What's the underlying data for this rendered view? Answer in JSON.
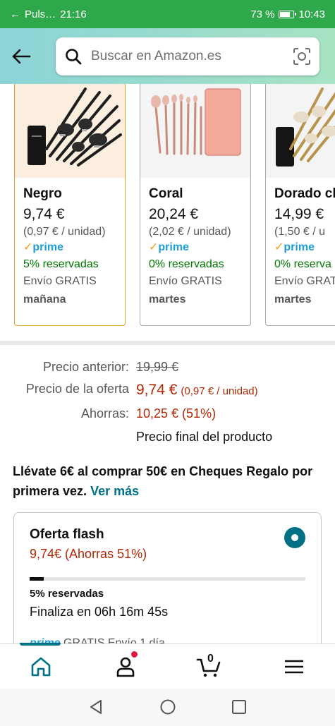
{
  "status_bar": {
    "app_label": "Puls…",
    "time_left": "21:16",
    "battery": "73 %",
    "time_right": "10:43"
  },
  "header": {
    "search_placeholder": "Buscar en Amazon.es"
  },
  "variants": [
    {
      "name": "Negro",
      "price": "9,74 €",
      "unit_price": "(0,97 € / unidad)",
      "prime": "prime",
      "reserved": "5% reservadas",
      "shipping": "Envío GRATIS",
      "delivery": "mañana",
      "selected": true
    },
    {
      "name": "Coral",
      "price": "20,24 €",
      "unit_price": "(2,02 € / unidad)",
      "prime": "prime",
      "reserved": "0% reservadas",
      "shipping": "Envío GRATIS",
      "delivery": "martes",
      "selected": false
    },
    {
      "name": "Dorado cl",
      "price": "14,99 €",
      "unit_price": "(1,50 € / u",
      "prime": "prime",
      "reserved": "0% reserva",
      "shipping": "Envío GRAT",
      "delivery": "martes",
      "selected": false
    }
  ],
  "pricing": {
    "previous_label": "Precio anterior:",
    "previous_value": "19,99 €",
    "offer_label": "Precio de la oferta",
    "offer_value": "9,74 €",
    "offer_unit": "(0,97 € / unidad)",
    "savings_label": "Ahorras:",
    "savings_value": "10,25 € (51%)",
    "final_note": "Precio final del producto"
  },
  "promo": {
    "text": "Llévate 6€ al comprar 50€ en Cheques Regalo por primera vez.",
    "link": "Ver más"
  },
  "flash_offer": {
    "title": "Oferta flash",
    "subtitle": "9,74€ (Ahorras 51%)",
    "reserved_fraction": 0.05,
    "reserved": "5% reservadas",
    "ends": "Finaliza en 06h 16m 45s",
    "shipping_prime": "prime",
    "shipping_text": "GRATIS Envío 1 día"
  },
  "bottom_nav": {
    "cart_count": "0"
  },
  "colors": {
    "teal": "#007185",
    "price_red": "#b12704",
    "green": "#007600",
    "prime_blue": "#1f9dd9"
  }
}
